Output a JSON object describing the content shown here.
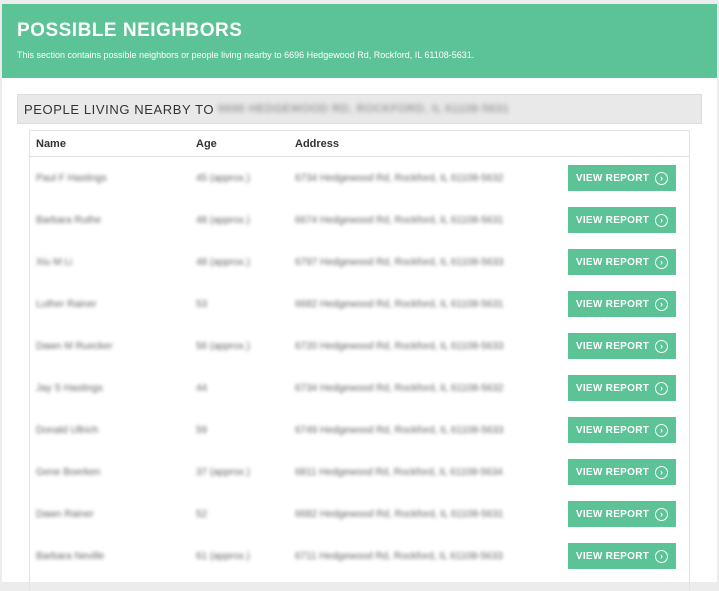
{
  "banner": {
    "title": "POSSIBLE NEIGHBORS",
    "subtitle": "This section contains possible neighbors or people living nearby to 6696 Hedgewood Rd, Rockford, IL 61108-5631."
  },
  "section": {
    "label": "PEOPLE LIVING NEARBY TO",
    "address": "6696 HEDGEWOOD RD, ROCKFORD, IL 61108-5631"
  },
  "table": {
    "headers": {
      "name": "Name",
      "age": "Age",
      "address": "Address"
    },
    "button_label": "VIEW REPORT",
    "rows": [
      {
        "name": "Paul F Hastings",
        "age": "45 (approx.)",
        "address": "6734 Hedgewood Rd, Rockford, IL 61108-5632"
      },
      {
        "name": "Barbara Ruthe",
        "age": "48 (approx.)",
        "address": "6674 Hedgewood Rd, Rockford, IL 61108-5631"
      },
      {
        "name": "Xiu M Li",
        "age": "48 (approx.)",
        "address": "6797 Hedgewood Rd, Rockford, IL 61108-5633"
      },
      {
        "name": "Luther Rainer",
        "age": "53",
        "address": "6682 Hedgewood Rd, Rockford, IL 61108-5631"
      },
      {
        "name": "Dawn M Ruecker",
        "age": "56 (approx.)",
        "address": "6720 Hedgewood Rd, Rockford, IL 61108-5633"
      },
      {
        "name": "Jay S Hastings",
        "age": "44",
        "address": "6734 Hedgewood Rd, Rockford, IL 61108-5632"
      },
      {
        "name": "Donald Ullrich",
        "age": "59",
        "address": "6749 Hedgewood Rd, Rockford, IL 61108-5633"
      },
      {
        "name": "Gene Boerken",
        "age": "37 (approx.)",
        "address": "6811 Hedgewood Rd, Rockford, IL 61108-5634"
      },
      {
        "name": "Dawn Rainer",
        "age": "52",
        "address": "6682 Hedgewood Rd, Rockford, IL 61108-5631"
      },
      {
        "name": "Barbara Neville",
        "age": "61 (approx.)",
        "address": "6711 Hedgewood Rd, Rockford, IL 61108-5633"
      }
    ]
  },
  "colors": {
    "accent": "#5bc395",
    "header_bg": "#e9e9e9"
  },
  "icons": {
    "button": "chevron-right-circle-icon"
  }
}
